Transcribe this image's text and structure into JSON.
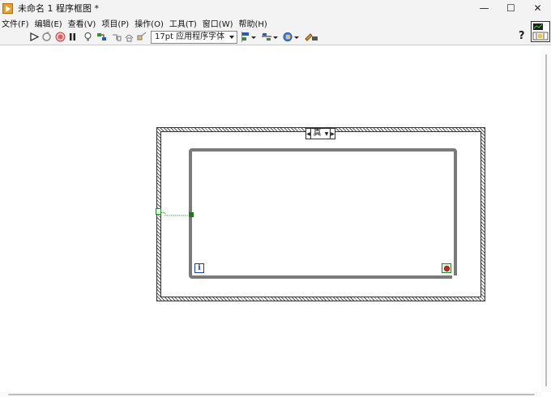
{
  "window": {
    "title": "未命名 1 程序框图 *",
    "minimize": "—",
    "maximize": "☐",
    "close": "✕"
  },
  "menu": [
    "文件(F)",
    "编辑(E)",
    "查看(V)",
    "项目(P)",
    "操作(O)",
    "工具(T)",
    "窗口(W)",
    "帮助(H)"
  ],
  "toolbar": {
    "font_select": "17pt 应用程序字体",
    "help": "?"
  },
  "diagram": {
    "case_selector_label": "真",
    "iteration_terminal": "i"
  },
  "colors": {
    "loop_border": "#7a7a7a",
    "wire_boolean": "#2a8a2a",
    "iteration_blue": "#1a3db8",
    "stop_red": "#e02020"
  }
}
